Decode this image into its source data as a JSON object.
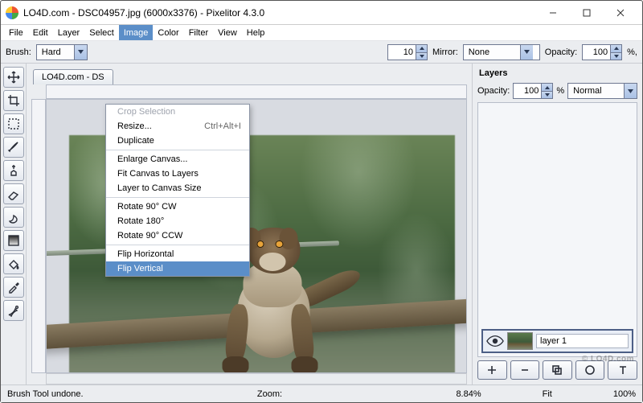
{
  "title": "LO4D.com - DSC04957.jpg (6000x3376) - Pixelitor 4.3.0",
  "menubar": [
    "File",
    "Edit",
    "Layer",
    "Select",
    "Image",
    "Color",
    "Filter",
    "View",
    "Help"
  ],
  "menubar_active_index": 4,
  "toolbar": {
    "brush_label": "Brush:",
    "brush_value": "Hard",
    "radius_value": "10",
    "mirror_label": "Mirror:",
    "mirror_value": "None",
    "opacity_label": "Opacity:",
    "opacity_value": "100",
    "opacity_suffix": " %,"
  },
  "doc_tab": "LO4D.com - DS",
  "image_menu": {
    "items": [
      {
        "label": "Crop Selection",
        "disabled": true
      },
      {
        "label": "Resize...",
        "accel": "Ctrl+Alt+I"
      },
      {
        "label": "Duplicate"
      },
      {
        "sep": true
      },
      {
        "label": "Enlarge Canvas..."
      },
      {
        "label": "Fit Canvas to Layers"
      },
      {
        "label": "Layer to Canvas Size"
      },
      {
        "sep": true
      },
      {
        "label": "Rotate 90° CW"
      },
      {
        "label": "Rotate 180°"
      },
      {
        "label": "Rotate 90° CCW"
      },
      {
        "sep": true
      },
      {
        "label": "Flip Horizontal"
      },
      {
        "label": "Flip Vertical",
        "selected": true
      }
    ]
  },
  "layers": {
    "title": "Layers",
    "opacity_label": "Opacity:",
    "opacity_value": "100",
    "pct": "%",
    "blend_value": "Normal",
    "layer_name": "layer 1"
  },
  "status": {
    "msg": "Brush Tool undone.",
    "zoom_label": "Zoom:",
    "zoom_value": "8.84%",
    "fit_label": "Fit",
    "fit_value": "100%"
  },
  "watermark": "© LO4D.com"
}
